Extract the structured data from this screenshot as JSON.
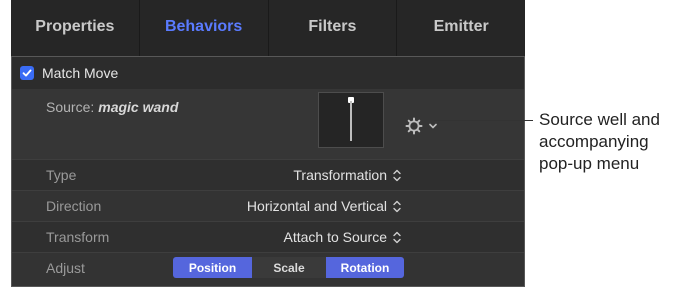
{
  "tabs": [
    "Properties",
    "Behaviors",
    "Filters",
    "Emitter"
  ],
  "active_tab": "Behaviors",
  "behavior": {
    "title": "Match Move",
    "enabled": true,
    "source_label": "Source:",
    "source_name": "magic wand",
    "properties": [
      {
        "label": "Type",
        "value": "Transformation"
      },
      {
        "label": "Direction",
        "value": "Horizontal and Vertical"
      },
      {
        "label": "Transform",
        "value": "Attach to Source"
      }
    ],
    "adjust": {
      "label": "Adjust",
      "segments": [
        {
          "label": "Position",
          "selected": true
        },
        {
          "label": "Scale",
          "selected": false
        },
        {
          "label": "Rotation",
          "selected": true
        }
      ]
    }
  },
  "callout": {
    "lines": [
      "Source well and",
      "accompanying",
      "pop-up menu"
    ]
  },
  "colors": {
    "accent": "#3a6cf5",
    "segment_on": "#5566dd",
    "active_tab": "#5a7bff"
  },
  "icons": [
    "checkmark-icon",
    "gear-icon",
    "chevron-down-icon",
    "updown-arrows-icon"
  ]
}
